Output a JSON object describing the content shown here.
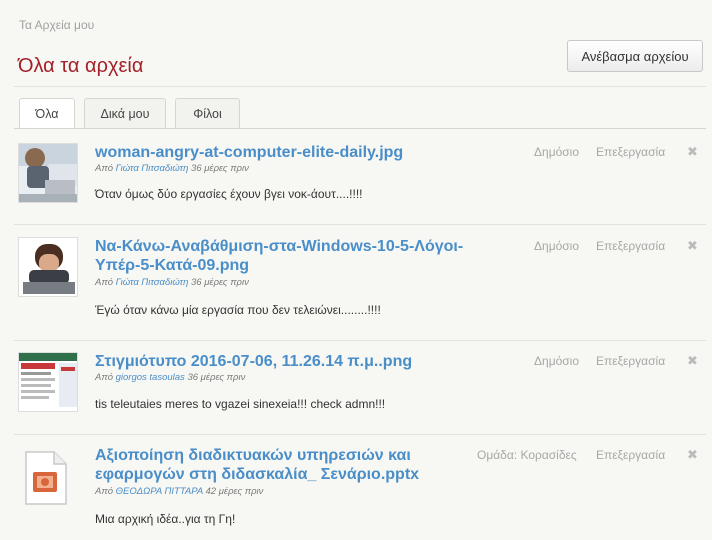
{
  "header": {
    "breadcrumb": "Τα Αρχεία μου",
    "title": "Όλα τα αρχεία",
    "upload_label": "Ανέβασμα αρχείου"
  },
  "tabs": [
    {
      "label": "Όλα",
      "active": true
    },
    {
      "label": "Δικά μου",
      "active": false
    },
    {
      "label": "Φίλοι",
      "active": false
    }
  ],
  "files": [
    {
      "title_lines": [
        "woman-angry-at-computer-elite-daily.jpg"
      ],
      "meta_prefix": "Από",
      "author": "Γιώτα Πιτσαδιώτη",
      "age": "36 μέρες πριν",
      "description": "Όταν όμως δύο εργασίες έχουν βγει νοκ-άουτ....!!!!",
      "privacy": "Δημόσιο",
      "edit_label": "Επεξεργασία",
      "delete_glyph": "✖",
      "thumb_icon": "photo-thumbnail"
    },
    {
      "title_lines": [
        "Να-Κάνω-Αναβάθμιση-στα-Windows-10-5-Λόγοι-",
        "Υπέρ-5-Κατά-09.png"
      ],
      "meta_prefix": "Από",
      "author": "Γιώτα Πιτσαδιώτη",
      "age": "36 μέρες πριν",
      "description": "Έγώ όταν κάνω μία εργασία που δεν τελειώνει........!!!!",
      "privacy": "Δημόσιο",
      "edit_label": "Επεξεργασία",
      "delete_glyph": "✖",
      "thumb_icon": "photo-thumbnail"
    },
    {
      "title_lines": [
        "Στιγμιότυπο 2016-07-06, 11.26.14 π.μ..png"
      ],
      "meta_prefix": "Από",
      "author": "giorgos tasoulas",
      "age": "36 μέρες πριν",
      "description": "tis teleutaies meres to vgazei sinexeia!!! check admn!!!",
      "privacy": "Δημόσιο",
      "edit_label": "Επεξεργασία",
      "delete_glyph": "✖",
      "thumb_icon": "screenshot-thumbnail"
    },
    {
      "title_lines": [
        "Αξιοποίηση διαδικτυακών υπηρεσιών και",
        "εφαρμογών στη διδασκαλία_ Σενάριο.pptx"
      ],
      "meta_prefix": "Από",
      "author": "ΘΕΟΔΩΡΑ ΠΙΤΤΑΡΑ",
      "age": "42 μέρες πριν",
      "description": "Μια αρχική ιδέα..για τη Γη!",
      "privacy": "Ομάδα: Κορασίδες",
      "edit_label": "Επεξεργασία",
      "delete_glyph": "✖",
      "thumb_icon": "pptx-file-icon"
    }
  ],
  "colors": {
    "title_red": "#a3202a",
    "link_blue": "#4a8ec9",
    "muted": "#a7a7a7"
  }
}
